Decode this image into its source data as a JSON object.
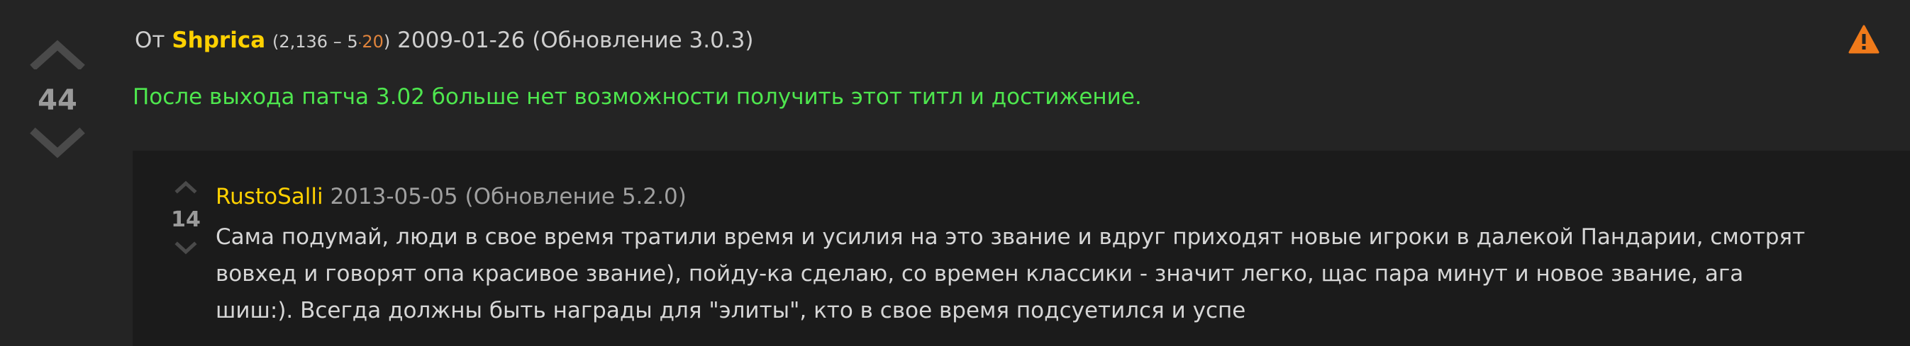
{
  "comment": {
    "score": "44",
    "prefix": "От",
    "author": "Shprica",
    "rep_open": "(",
    "reputation": "2,136",
    "rep_sep": "–",
    "badge_level": "5",
    "badge_dot": "·",
    "badge_count": "20",
    "rep_close": ")",
    "date": "2009-01-26",
    "patch": "(Обновление 3.0.3)",
    "text": "После выхода патча 3.02 больше нет возможности получить этот титл и достижение.",
    "icons": {
      "upvote": "chevron-up-icon",
      "downvote": "chevron-down-icon",
      "report": "warning-icon"
    },
    "colors": {
      "author": "#ffd100",
      "text": "#4ee64e",
      "report": "#f07a1a",
      "badge": "#e0843c"
    }
  },
  "reply": {
    "score": "14",
    "author": "RustoSalli",
    "date": "2013-05-05",
    "patch": "(Обновление 5.2.0)",
    "lines": [
      "Сама подумай, люди в свое время тратили время и усилия на это звание и вдруг приходят новые игроки в далекой Пандарии, смотрят",
      "вовхед и говорят опа красивое звание), пойду-ка сделаю, со времен классики - значит легко, щас пара минут и новое звание, ага",
      "шиш:). Всегда должны быть награды для \"элиты\", кто в свое время подсуетился и успе"
    ]
  }
}
